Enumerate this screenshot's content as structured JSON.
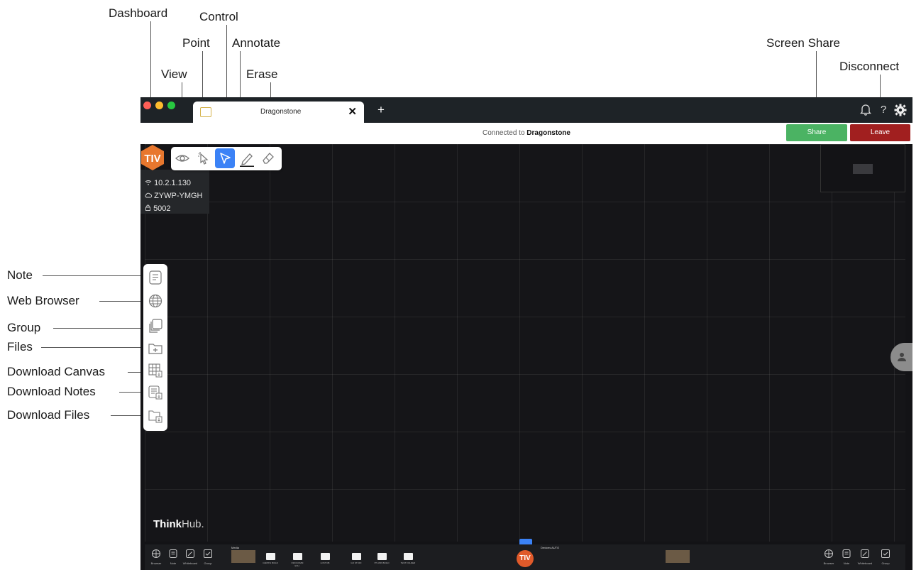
{
  "callouts": {
    "dashboard": "Dashboard",
    "control": "Control",
    "point": "Point",
    "annotate": "Annotate",
    "view": "View",
    "erase": "Erase",
    "screen_share": "Screen Share",
    "disconnect": "Disconnect",
    "note": "Note",
    "web_browser": "Web Browser",
    "group": "Group",
    "files": "Files",
    "download_canvas": "Download Canvas",
    "download_notes": "Download Notes",
    "download_files": "Download Files"
  },
  "titlebar": {
    "tab_title": "Dragonstone",
    "close_glyph": "✕",
    "new_tab_glyph": "+",
    "help_glyph": "?",
    "traffic_colors": [
      "#ff5f57",
      "#febc2e",
      "#28c840"
    ]
  },
  "connection": {
    "prefix": "Connected to",
    "room": "Dragonstone"
  },
  "actions": {
    "share": "Share",
    "leave": "Leave",
    "share_color": "#4bb363",
    "leave_color": "#a11f1f"
  },
  "logo": {
    "text": "TIV",
    "color": "#e8772e"
  },
  "info": {
    "ip": "10.2.1.130",
    "code": "ZYWP-YMGH",
    "port": "5002"
  },
  "branding": {
    "think": "Think",
    "hub": "Hub."
  },
  "toolbar": {
    "active_tool": "control",
    "active_color": "#3b82f6"
  },
  "sidebar_items": [
    "note",
    "web-browser",
    "group",
    "files",
    "download-canvas",
    "download-notes",
    "download-files"
  ],
  "bottombar": {
    "left_labels": [
      "Browser",
      "Note",
      "Whiteboard",
      "Group"
    ],
    "media_label": "Media",
    "folders": [
      "CHRIS'S BUILD",
      "INFOCOMM EXH.",
      "LOST DB",
      "GO STUFF",
      "ITS WIN BUILD",
      "TEST FOLDER"
    ],
    "devices_label": "Devices AUTO",
    "center_logo": "TIV",
    "right_labels": [
      "Browser",
      "Note",
      "Whiteboard",
      "Group"
    ]
  }
}
